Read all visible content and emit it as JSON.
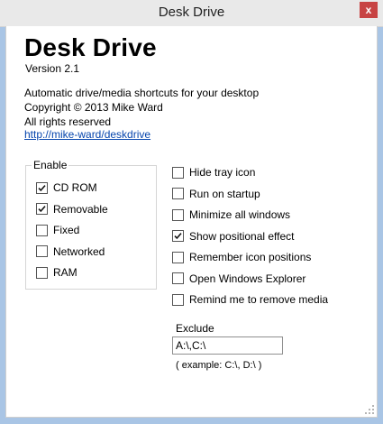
{
  "window": {
    "title": "Desk Drive",
    "close_label": "x"
  },
  "about": {
    "app_name": "Desk Drive",
    "version": "Version 2.1",
    "description": "Automatic drive/media shortcuts for your desktop",
    "copyright": "Copyright © 2013 Mike Ward",
    "rights": "All rights reserved",
    "link": "http://mike-ward/deskdrive"
  },
  "enable_group": {
    "legend": "Enable",
    "items": [
      {
        "label": "CD ROM",
        "checked": true
      },
      {
        "label": "Removable",
        "checked": true
      },
      {
        "label": "Fixed",
        "checked": false
      },
      {
        "label": "Networked",
        "checked": false
      },
      {
        "label": "RAM",
        "checked": false
      }
    ]
  },
  "options": [
    {
      "label": "Hide tray icon",
      "checked": false
    },
    {
      "label": "Run on startup",
      "checked": false
    },
    {
      "label": "Minimize all windows",
      "checked": false
    },
    {
      "label": "Show positional effect",
      "checked": true
    },
    {
      "label": "Remember icon positions",
      "checked": false
    },
    {
      "label": "Open Windows Explorer",
      "checked": false
    },
    {
      "label": "Remind me to remove media",
      "checked": false
    }
  ],
  "exclude": {
    "label": "Exclude",
    "value": "A:\\,C:\\",
    "example": "( example: C:\\, D:\\ )"
  }
}
